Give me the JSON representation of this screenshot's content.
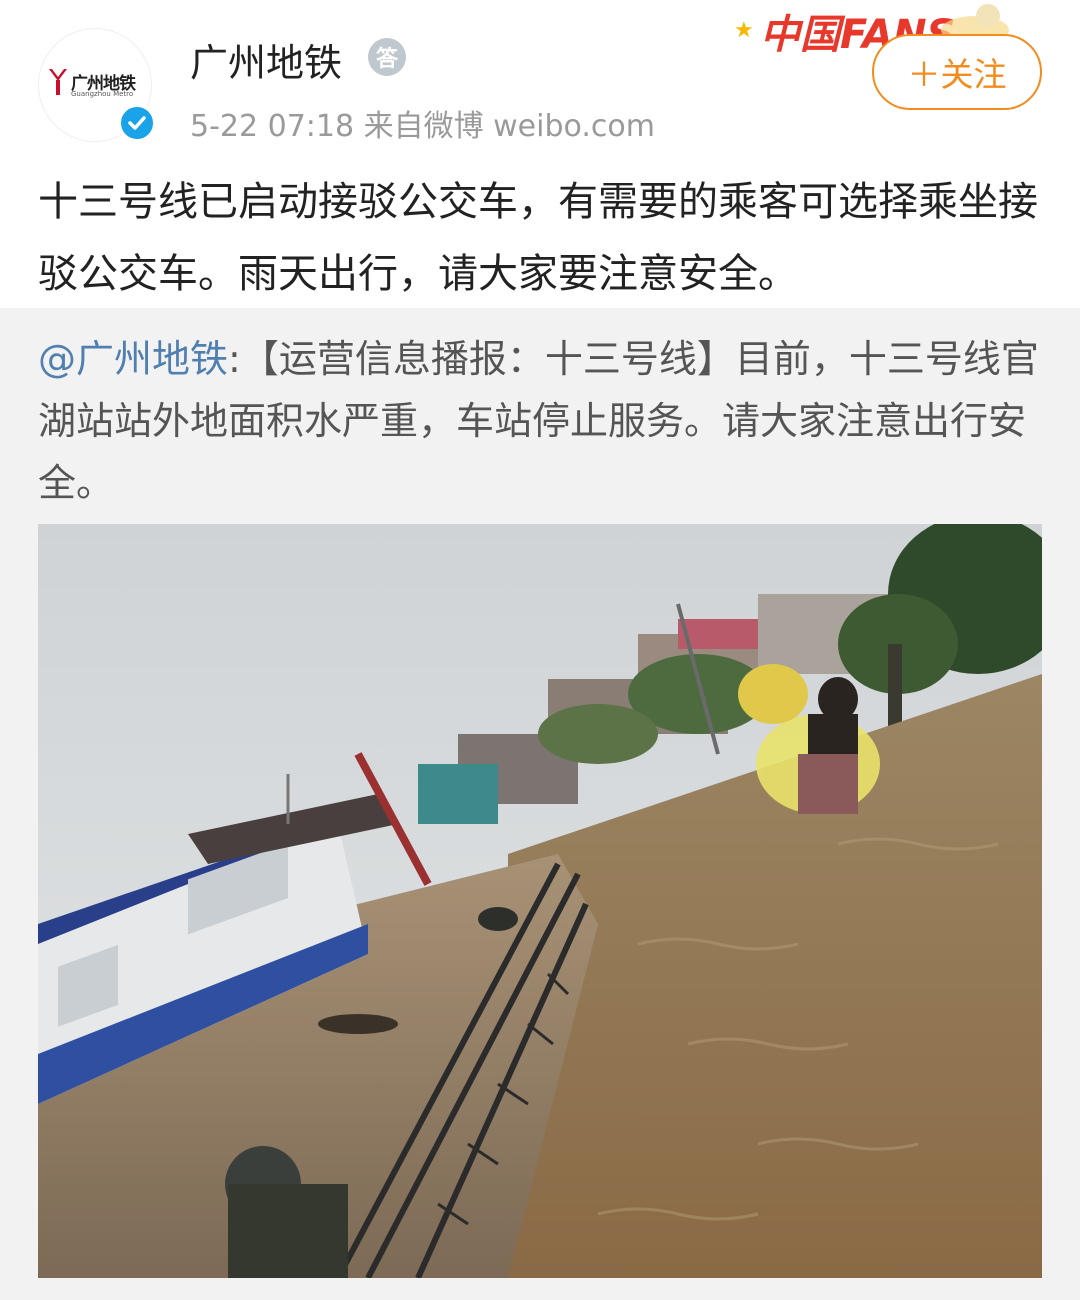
{
  "account": {
    "name": "广州地铁",
    "avatar_logo_cn": "广州地铁",
    "avatar_logo_en": "Guangzhou Metro",
    "medal_text": "答",
    "meta": "5-22 07:18  来自微博 weibo.com"
  },
  "badge": {
    "text": "中国FANS"
  },
  "follow_button": {
    "label": "＋关注"
  },
  "post": {
    "text": "十三号线已启动接驳公交车，有需要的乘客可选择乘坐接驳公交车。雨天出行，请大家要注意安全。"
  },
  "retweet": {
    "mention": "@广州地铁",
    "text": ":【运营信息播报：十三号线】目前，十三号线官湖站站外地面积水严重，车站停止服务。请大家注意出行安全。"
  },
  "photo": {
    "description_icon": "flood-street-photo"
  },
  "colors": {
    "accent_orange": "#f28c1e",
    "verified_blue": "#1aa3e8",
    "mention_blue": "#517fb0",
    "badge_red": "#e8382c"
  }
}
